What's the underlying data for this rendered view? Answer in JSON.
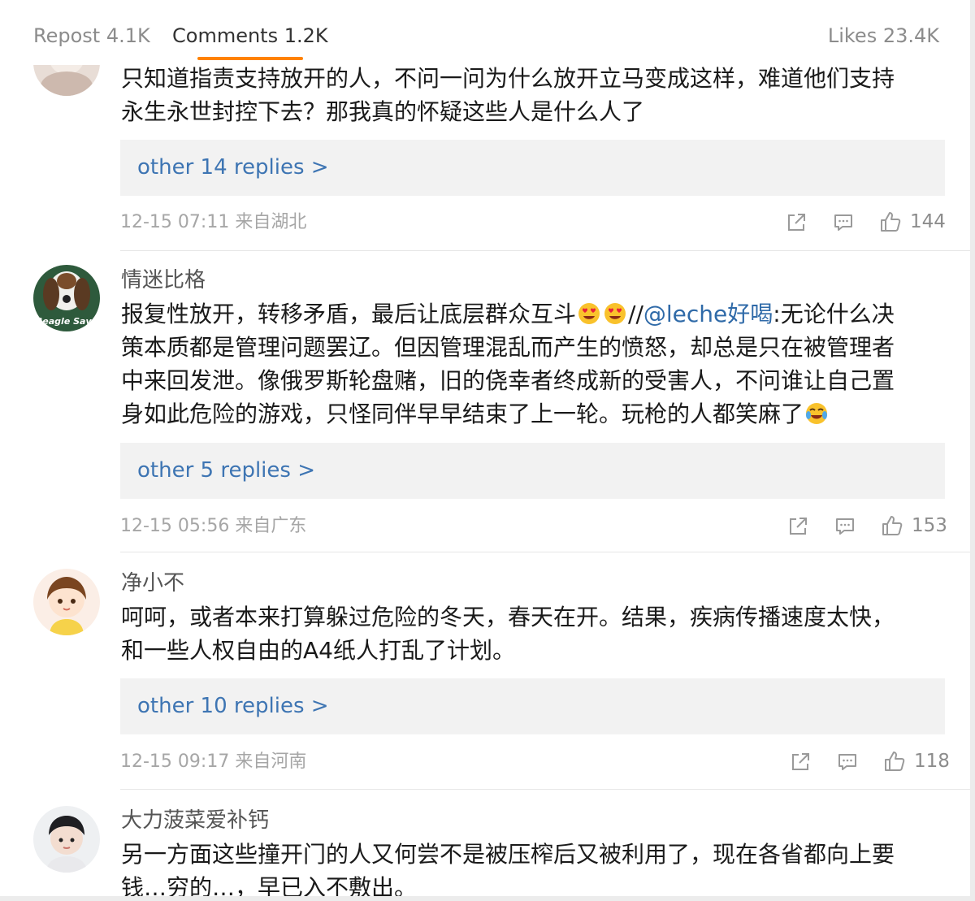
{
  "tabs": {
    "repost": "Repost 4.1K",
    "comments": "Comments 1.2K",
    "likes": "Likes 23.4K",
    "active_color": "#ff8200"
  },
  "comments": [
    {
      "username": "",
      "text_lines": [
        "只知道指责支持放开的人，不问一问为什么放开立马变成这样，难道他们支持",
        "永生永世封控下去？那我真的怀疑这些人是什么人了"
      ],
      "replies": "other 14 replies >",
      "meta": "12-15 07:11 来自湖北",
      "likes": "144"
    },
    {
      "username": "情迷比格",
      "line1_prefix": "报复性放开，转移矛盾，最后让底层群众互斗",
      "line1_separator": "//",
      "line1_mention": "@leche好喝",
      "line1_suffix": ":无论什么决",
      "text_lines": [
        "策本质都是管理问题罢辽。但因管理混乱而产生的愤怒，却总是只在被管理者",
        "中来回发泄。像俄罗斯轮盘赌，旧的侥幸者终成新的受害人，不问谁让自己置",
        "身如此危险的游戏，只怪同伴早早结束了上一轮。玩枪的人都笑麻了"
      ],
      "replies": "other 5 replies >",
      "meta": "12-15 05:56 来自广东",
      "likes": "153",
      "avatar_text": "Beagle Save"
    },
    {
      "username": "净小不",
      "text_lines": [
        "呵呵，或者本来打算躲过危险的冬天，春天在开。结果，疾病传播速度太快，",
        "和一些人权自由的A4纸人打乱了计划。"
      ],
      "replies": "other 10 replies >",
      "meta": "12-15 09:17 来自河南",
      "likes": "118"
    },
    {
      "username": "大力菠菜爱补钙",
      "text_lines": [
        "另一方面这些撞开门的人又何尝不是被压榨后又被利用了，现在各省都向上要",
        "钱…穷的…，早已入不敷出。"
      ]
    }
  ],
  "icons": {
    "share": "share-icon",
    "comment": "comment-icon",
    "like": "thumbs-up-icon",
    "emoji_heart_eyes": "heart-eyes-emoji",
    "emoji_laugh_cry": "tears-of-joy-emoji"
  },
  "colors": {
    "mention": "#2f6aa8",
    "replies_link": "#3e75b3",
    "replies_bg": "#f2f2f2"
  }
}
